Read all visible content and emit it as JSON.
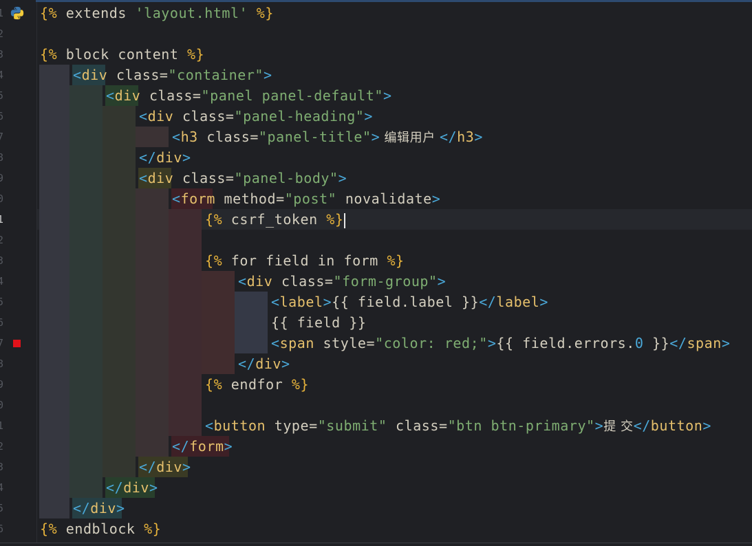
{
  "editor": {
    "language_icon": "python-icon",
    "breakpoint_line": 17,
    "active_line": 11,
    "line_numbers": [
      "1",
      "2",
      "3",
      "4",
      "5",
      "6",
      "7",
      "8",
      "9",
      "0",
      "1",
      "2",
      "3",
      "4",
      "5",
      "6",
      "7",
      "8",
      "9",
      "0",
      "1",
      "2",
      "3",
      "4",
      "5",
      "6"
    ]
  },
  "code": {
    "l1": [
      "{%",
      " extends ",
      "'layout.html'",
      " %}"
    ],
    "l3": [
      "{%",
      " block ",
      "content",
      " %}"
    ],
    "l4": [
      "<",
      "div",
      " class",
      "=",
      "\"container\"",
      ">"
    ],
    "l5": [
      "<",
      "div",
      " class",
      "=",
      "\"panel panel-default\"",
      ">"
    ],
    "l6": [
      "<",
      "div",
      " class",
      "=",
      "\"panel-heading\"",
      ">"
    ],
    "l7": [
      "<",
      "h3",
      " class",
      "=",
      "\"panel-title\"",
      ">",
      " 编辑用户 ",
      "</",
      "h3",
      ">"
    ],
    "l8": [
      "</",
      "div",
      ">"
    ],
    "l9": [
      "<",
      "div",
      " class",
      "=",
      "\"panel-body\"",
      ">"
    ],
    "l10": [
      "<",
      "form",
      " method",
      "=",
      "\"post\"",
      " novalidate",
      ">"
    ],
    "l11": [
      "{%",
      " csrf_token ",
      "%}"
    ],
    "l13": [
      "{%",
      " for ",
      "field ",
      "in ",
      "form ",
      "%}"
    ],
    "l14": [
      "<",
      "div",
      " class",
      "=",
      "\"form-group\"",
      ">"
    ],
    "l15": [
      "<",
      "label",
      ">",
      "{{ field.label }}",
      "</",
      "label",
      ">"
    ],
    "l16": [
      "{{ field }}"
    ],
    "l17": [
      "<",
      "span",
      " style",
      "=",
      "\"color: ",
      "red",
      ";\"",
      ">",
      "{{ field.errors.",
      "0",
      " }}",
      "</",
      "span",
      ">"
    ],
    "l18": [
      "</",
      "div",
      ">"
    ],
    "l19": [
      "{%",
      " endfor ",
      "%}"
    ],
    "l21": [
      "<",
      "button",
      " type",
      "=",
      "\"submit\"",
      " class",
      "=",
      "\"btn btn-primary\"",
      ">",
      "提 交",
      "</",
      "button",
      ">"
    ],
    "l22": [
      "</",
      "form",
      ">"
    ],
    "l23": [
      "</",
      "div",
      ">"
    ],
    "l24": [
      "</",
      "div",
      ">"
    ],
    "l25": [
      "</",
      "div",
      ">"
    ],
    "l26": [
      "{%",
      " endblock ",
      "%}"
    ]
  },
  "colors": {
    "background": "#1f2024",
    "jinja": "#e7b33b",
    "string": "#7fae72",
    "bracket": "#4aa8d8",
    "breakpoint": "#e1121a"
  }
}
